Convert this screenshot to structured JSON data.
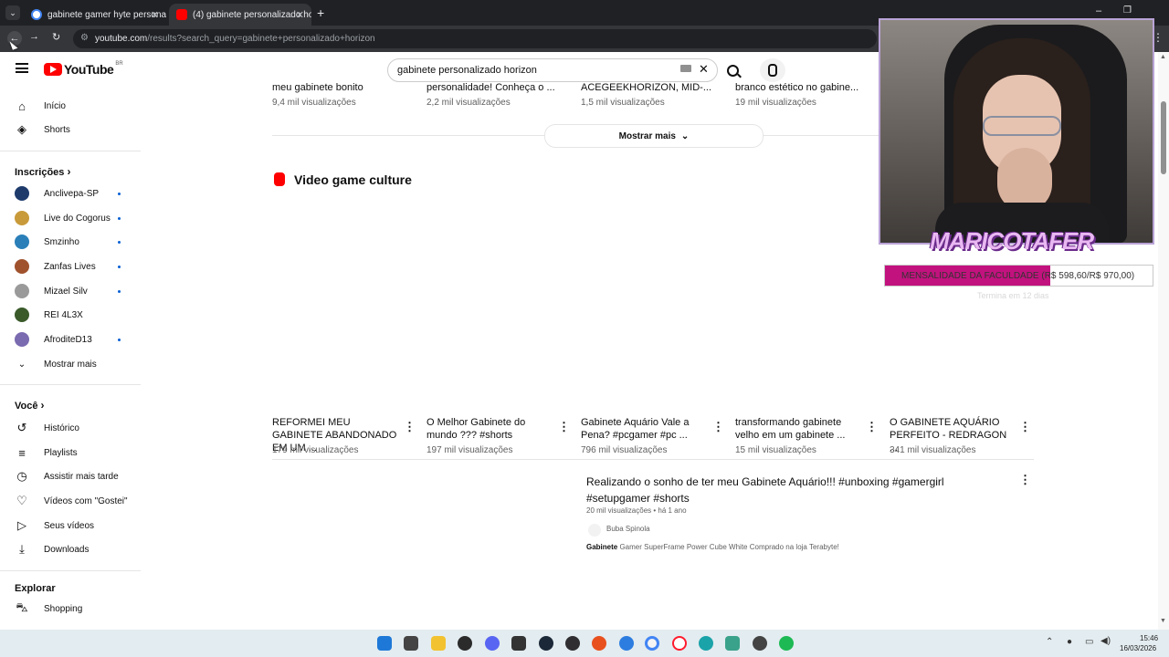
{
  "browser": {
    "tabs": [
      {
        "title": "gabinete gamer hyte personaliz"
      },
      {
        "title": "(4) gabinete personalizado hor"
      }
    ],
    "url_host": "youtube.com",
    "url_rest": "/results?search_query=gabinete+personalizado+horizon"
  },
  "youtube": {
    "logo_text": "YouTube",
    "region": "BR",
    "search_value": "gabinete personalizado horizon"
  },
  "sidebar": {
    "main": [
      {
        "label": "Início",
        "icon": "home-icon"
      },
      {
        "label": "Shorts",
        "icon": "shorts-icon"
      }
    ],
    "subscriptions_title": "Inscrições",
    "subscriptions": [
      {
        "label": "Anclivepa-SP",
        "color": "#1d3a6b"
      },
      {
        "label": "Live do Cogorus",
        "color": "#c89a3a"
      },
      {
        "label": "Smzinho",
        "color": "#2a7fb8"
      },
      {
        "label": "Zanfas Lives",
        "color": "#a0522d"
      },
      {
        "label": "Mizael Silv",
        "color": "#9a9a9a"
      },
      {
        "label": "REI 4L3X",
        "color": "#3a5a2a"
      },
      {
        "label": "AfroditeD13",
        "color": "#7a6ab0"
      }
    ],
    "show_more": "Mostrar mais",
    "you_title": "Você",
    "you_items": [
      {
        "label": "Histórico",
        "icon": "history-icon"
      },
      {
        "label": "Playlists",
        "icon": "playlists-icon"
      },
      {
        "label": "Assistir mais tarde",
        "icon": "watch-later-icon"
      },
      {
        "label": "Vídeos com \"Gostei\"",
        "icon": "like-icon"
      },
      {
        "label": "Seus vídeos",
        "icon": "your-videos-icon"
      },
      {
        "label": "Downloads",
        "icon": "download-icon"
      }
    ],
    "explore_title": "Explorar",
    "explore_items": [
      {
        "label": "Shopping",
        "icon": "shopping-icon"
      }
    ]
  },
  "top_row": [
    {
      "title": "meu gabinete bonito",
      "views": "9,4 mil visualizações"
    },
    {
      "title": "personalidade! Conheça o ...",
      "views": "2,2 mil visualizações"
    },
    {
      "title": "ACEGEEKHORIZON, MID-...",
      "views": "1,5 mil visualizações"
    },
    {
      "title": "branco estético no gabine...",
      "views": "19 mil visualizações"
    }
  ],
  "show_more_results": "Mostrar mais",
  "shelf_title": "Video game culture",
  "shorts": [
    {
      "title": "REFORMEI MEU GABINETE ABANDONADO EM UM ...",
      "views": "179 mil visualizações"
    },
    {
      "title": "O Melhor Gabinete do mundo ??? #shorts",
      "views": "197 mil visualizações"
    },
    {
      "title": "Gabinete Aquário Vale a Pena? #pcgamer #pc ...",
      "views": "796 mil visualizações"
    },
    {
      "title": "transformando  gabinete velho em um gabinete ...",
      "views": "15 mil visualizações"
    },
    {
      "title": "O GABINETE AQUÁRIO PERFEITO - REDRAGON ...",
      "views": "341 mil visualizações"
    }
  ],
  "video_result": {
    "title": "Realizando o sonho de ter meu Gabinete Aquário!!! #unboxing #gamergirl #setupgamer #shorts",
    "meta": "20 mil visualizações • há 1 ano",
    "channel": "Buba Spinola",
    "desc_bold": "Gabinete",
    "desc_rest": " Gamer SuperFrame Power Cube White Comprado na loja Terabyte!"
  },
  "overlay": {
    "brand": "MARICOTAFER",
    "goal_text": "MENSALIDADE DA FACULDADE (R$ 598,60/R$ 970,00)",
    "goal_progress": 0.617,
    "goal_sub": "Termina em 12 dias",
    "goal_color": "#c2127e"
  },
  "taskbar": {
    "time": "15:46",
    "date": "16/03/2026"
  }
}
